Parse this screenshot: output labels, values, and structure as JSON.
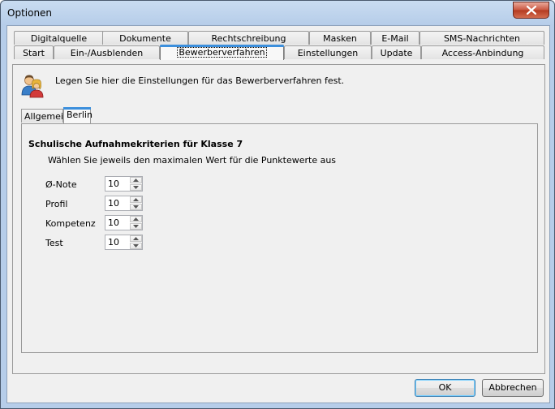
{
  "window": {
    "title": "Optionen"
  },
  "tabs_row1": [
    "Digitalquelle",
    "Dokumente",
    "Rechtschreibung",
    "Masken",
    "E-Mail",
    "SMS-Nachrichten"
  ],
  "tabs_row2": [
    "Start",
    "Ein-/Ausblenden",
    "Bewerberverfahren",
    "Einstellungen",
    "Update",
    "Access-Anbindung"
  ],
  "active_tab": "Bewerberverfahren",
  "header": {
    "text": "Legen Sie hier die Einstellungen für das Bewerberverfahren fest.",
    "icon": "users-icon"
  },
  "inner_tabs": [
    "Allgemein",
    "Berlin"
  ],
  "active_inner_tab": "Berlin",
  "section": {
    "title": "Schulische Aufnahmekriterien für Klasse 7",
    "description": "Wählen Sie jeweils den maximalen Wert für die Punktewerte aus"
  },
  "fields": [
    {
      "label": "Ø-Note",
      "value": "10"
    },
    {
      "label": "Profil",
      "value": "10"
    },
    {
      "label": "Kompetenz",
      "value": "10"
    },
    {
      "label": "Test",
      "value": "10"
    }
  ],
  "buttons": {
    "ok": "OK",
    "cancel": "Abbrechen"
  },
  "colors": {
    "titlebar": "#b6cde9",
    "accent": "#3c8fdc",
    "close": "#c9553f"
  }
}
